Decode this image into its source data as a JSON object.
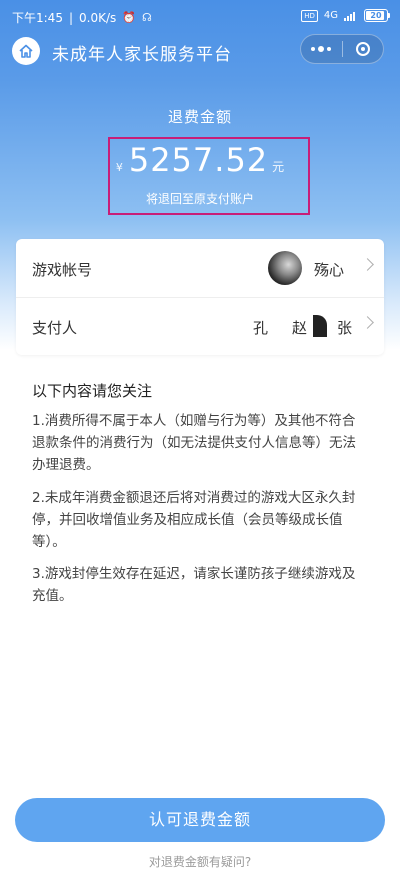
{
  "status_bar": {
    "time": "下午1:45",
    "network_speed": "0.0K/s",
    "network_type": "4G",
    "hd_badge": "HD",
    "battery": "20"
  },
  "nav": {
    "title": "未成年人家长服务平台"
  },
  "refund": {
    "title": "退费金额",
    "currency": "¥",
    "amount": "5257.52",
    "unit": "元",
    "note": "将退回至原支付账户"
  },
  "account": {
    "game_account_label": "游戏帐号",
    "nickname": "殇心",
    "payer_label": "支付人",
    "payer_names": [
      "孔",
      "赵",
      "张"
    ]
  },
  "notice": {
    "title": "以下内容请您关注",
    "items": [
      "1.消费所得不属于本人（如赠与行为等）及其他不符合退款条件的消费行为（如无法提供支付人信息等）无法办理退费。",
      "2.未成年消费金额退还后将对消费过的游戏大区永久封停，并回收增值业务及相应成长值（会员等级成长值等）。",
      "3.游戏封停生效存在延迟，请家长谨防孩子继续游戏及充值。"
    ]
  },
  "actions": {
    "confirm_label": "认可退费金额",
    "query_label": "对退费金额有疑问?"
  },
  "colors": {
    "header_blue": "#4a90e6",
    "button_blue": "#5fa5f0",
    "highlight_border": "#c81e78"
  }
}
